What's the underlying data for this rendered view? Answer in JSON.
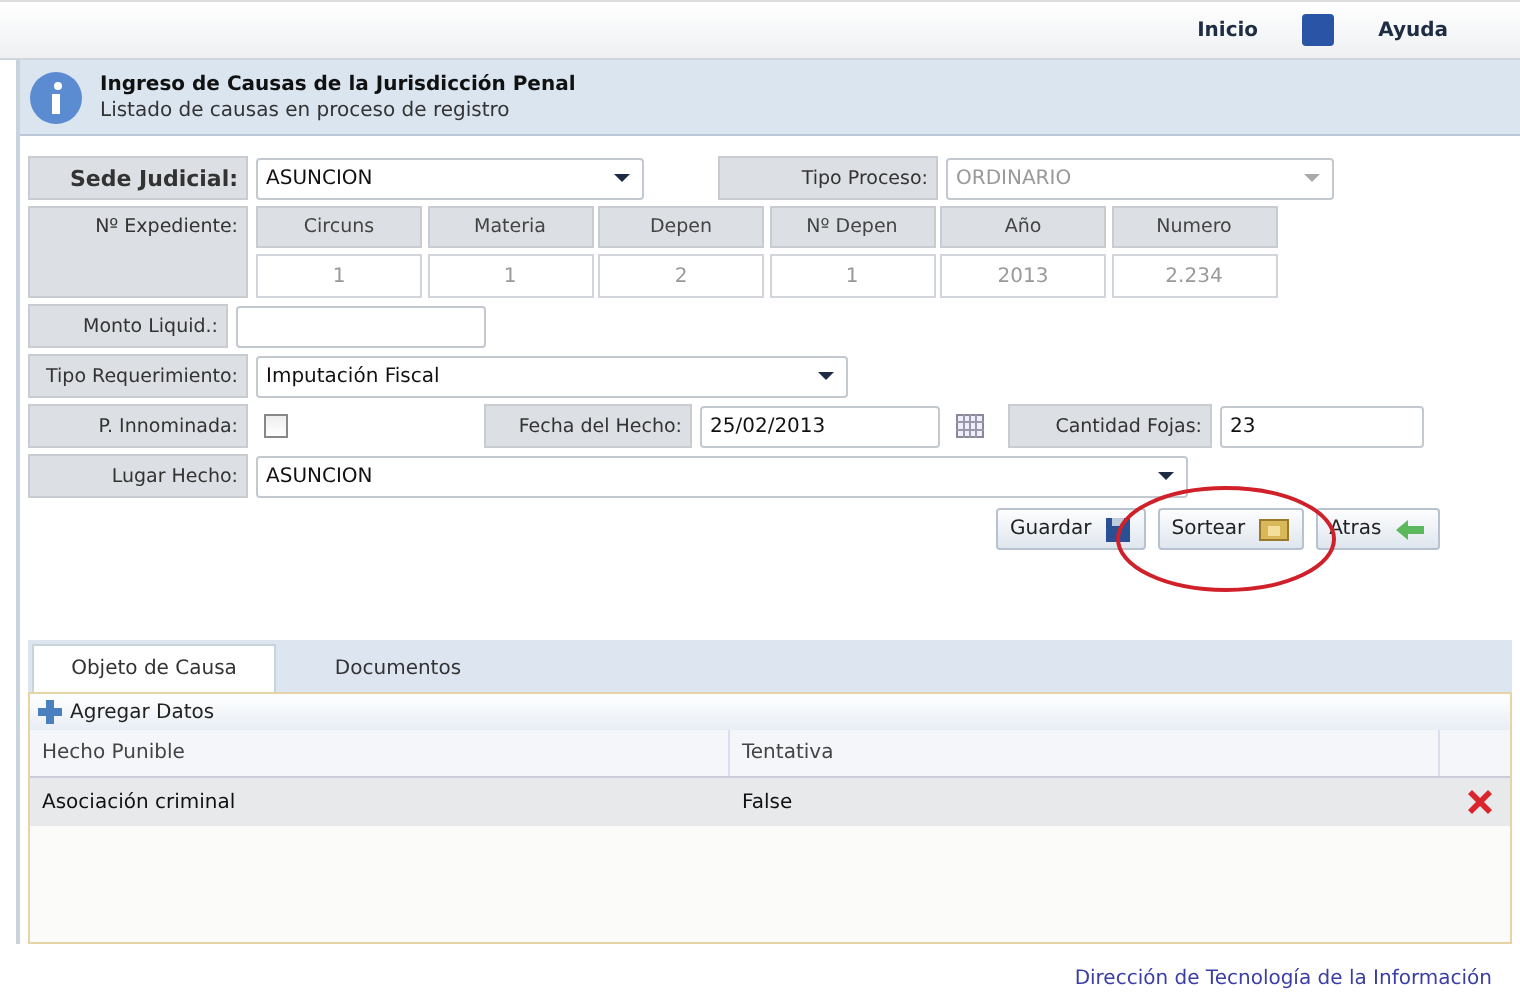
{
  "top_nav": {
    "links": [
      {
        "label": "Inicio",
        "kind": "text"
      },
      {
        "label": "Ayuda",
        "kind": "help"
      }
    ]
  },
  "page_header": {
    "title": "Ingreso de Causas de la Jurisdicción Penal",
    "subtitle": "Listado de causas en proceso de registro"
  },
  "form": {
    "sede_judicial": {
      "label": "Sede Judicial:",
      "value": "ASUNCION"
    },
    "tipo_proceso": {
      "label": "Tipo Proceso:",
      "value": "ORDINARIO",
      "disabled": true
    },
    "expediente": {
      "label": "Nº Expediente:",
      "readonly": true,
      "parts": [
        {
          "label": "Circuns",
          "value": "1"
        },
        {
          "label": "Materia",
          "value": "1"
        },
        {
          "label": "Depen",
          "value": "2"
        },
        {
          "label": "Nº Depen",
          "value": "1"
        },
        {
          "label": "Año",
          "value": "2013"
        },
        {
          "label": "Numero",
          "value": "2.234"
        }
      ]
    },
    "monto_liquid": {
      "label": "Monto Liquid.:"
    },
    "tipo_requerimiento": {
      "label": "Tipo Requerimiento:",
      "value": "Imputación Fiscal"
    },
    "p_innominada": {
      "label": "P. Innominada:",
      "checked": false
    },
    "fecha_hecho": {
      "label": "Fecha del Hecho:",
      "value": "25/02/2013"
    },
    "cantidad_fojas": {
      "label": "Cantidad Fojas:",
      "value": "23"
    },
    "lugar_hecho": {
      "label": "Lugar Hecho:",
      "value": "ASUNCION"
    }
  },
  "buttons": [
    {
      "label": "Guardar",
      "kind": "save",
      "highlighted": false
    },
    {
      "label": "Sortear",
      "kind": "draw",
      "highlighted": true
    },
    {
      "label": "Atras",
      "kind": "back",
      "highlighted": false
    }
  ],
  "tabs": [
    {
      "label": "Objeto de Causa",
      "selected": true
    },
    {
      "label": "Documentos",
      "selected": false
    }
  ],
  "grid": {
    "toolbar": {
      "label": "Agregar Datos"
    },
    "columns": [
      "Hecho Punible",
      "Tentativa"
    ],
    "rows": [
      {
        "cells": [
          "Asociación criminal",
          "False"
        ]
      }
    ]
  },
  "footer": "Dirección de Tecnología de la Información"
}
